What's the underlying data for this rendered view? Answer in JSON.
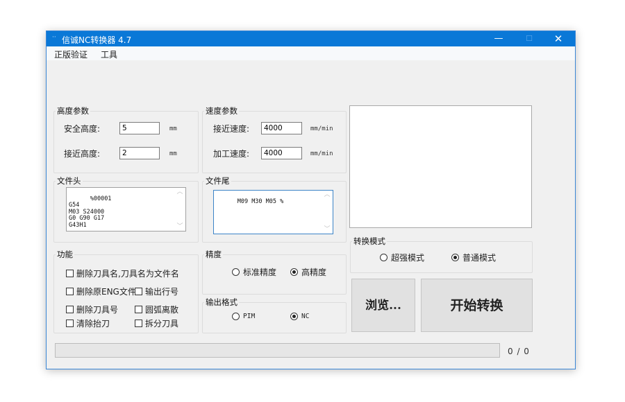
{
  "window": {
    "title": "信诚NC转换器 4.7",
    "controls": {
      "minimize": "—",
      "maximize": "☐",
      "close": "✕"
    }
  },
  "menu": [
    "正版验证",
    "工具"
  ],
  "height_params": {
    "legend": "高度参数",
    "safe_height": {
      "label": "安全高度:",
      "value": "5",
      "unit": "mm"
    },
    "approach_height": {
      "label": "接近高度:",
      "value": "2",
      "unit": "mm"
    }
  },
  "speed_params": {
    "legend": "速度参数",
    "approach_speed": {
      "label": "接近速度:",
      "value": "4000",
      "unit": "mm/min"
    },
    "machining_speed": {
      "label": "加工速度:",
      "value": "4000",
      "unit": "mm/min"
    }
  },
  "file_header": {
    "legend": "文件头",
    "content": "%00001\nG54\nM03 S24000\nG0 G90 G17\nG43H1"
  },
  "file_footer": {
    "legend": "文件尾",
    "content": "M09 M30 M05 %"
  },
  "functions": {
    "legend": "功能",
    "options": [
      {
        "label": "删除刀具名,刀具名为文件名",
        "checked": false
      },
      {
        "label": "删除原ENG文件",
        "checked": false
      },
      {
        "label": "输出行号",
        "checked": false
      },
      {
        "label": "删除刀具号",
        "checked": false
      },
      {
        "label": "圆弧离散",
        "checked": false
      },
      {
        "label": "清除抬刀",
        "checked": false
      },
      {
        "label": "拆分刀具",
        "checked": false
      }
    ]
  },
  "precision": {
    "legend": "精度",
    "options": [
      {
        "label": "标准精度",
        "selected": false
      },
      {
        "label": "高精度",
        "selected": true
      }
    ]
  },
  "output_format": {
    "legend": "输出格式",
    "options": [
      {
        "label": "PIM",
        "selected": false
      },
      {
        "label": "NC",
        "selected": true
      }
    ]
  },
  "convert_mode": {
    "legend": "转换模式",
    "options": [
      {
        "label": "超强模式",
        "selected": false
      },
      {
        "label": "普通模式",
        "selected": true
      }
    ]
  },
  "buttons": {
    "browse": "浏览...",
    "start": "开始转换"
  },
  "progress": {
    "fraction": 0,
    "counter": "0 / 0"
  }
}
